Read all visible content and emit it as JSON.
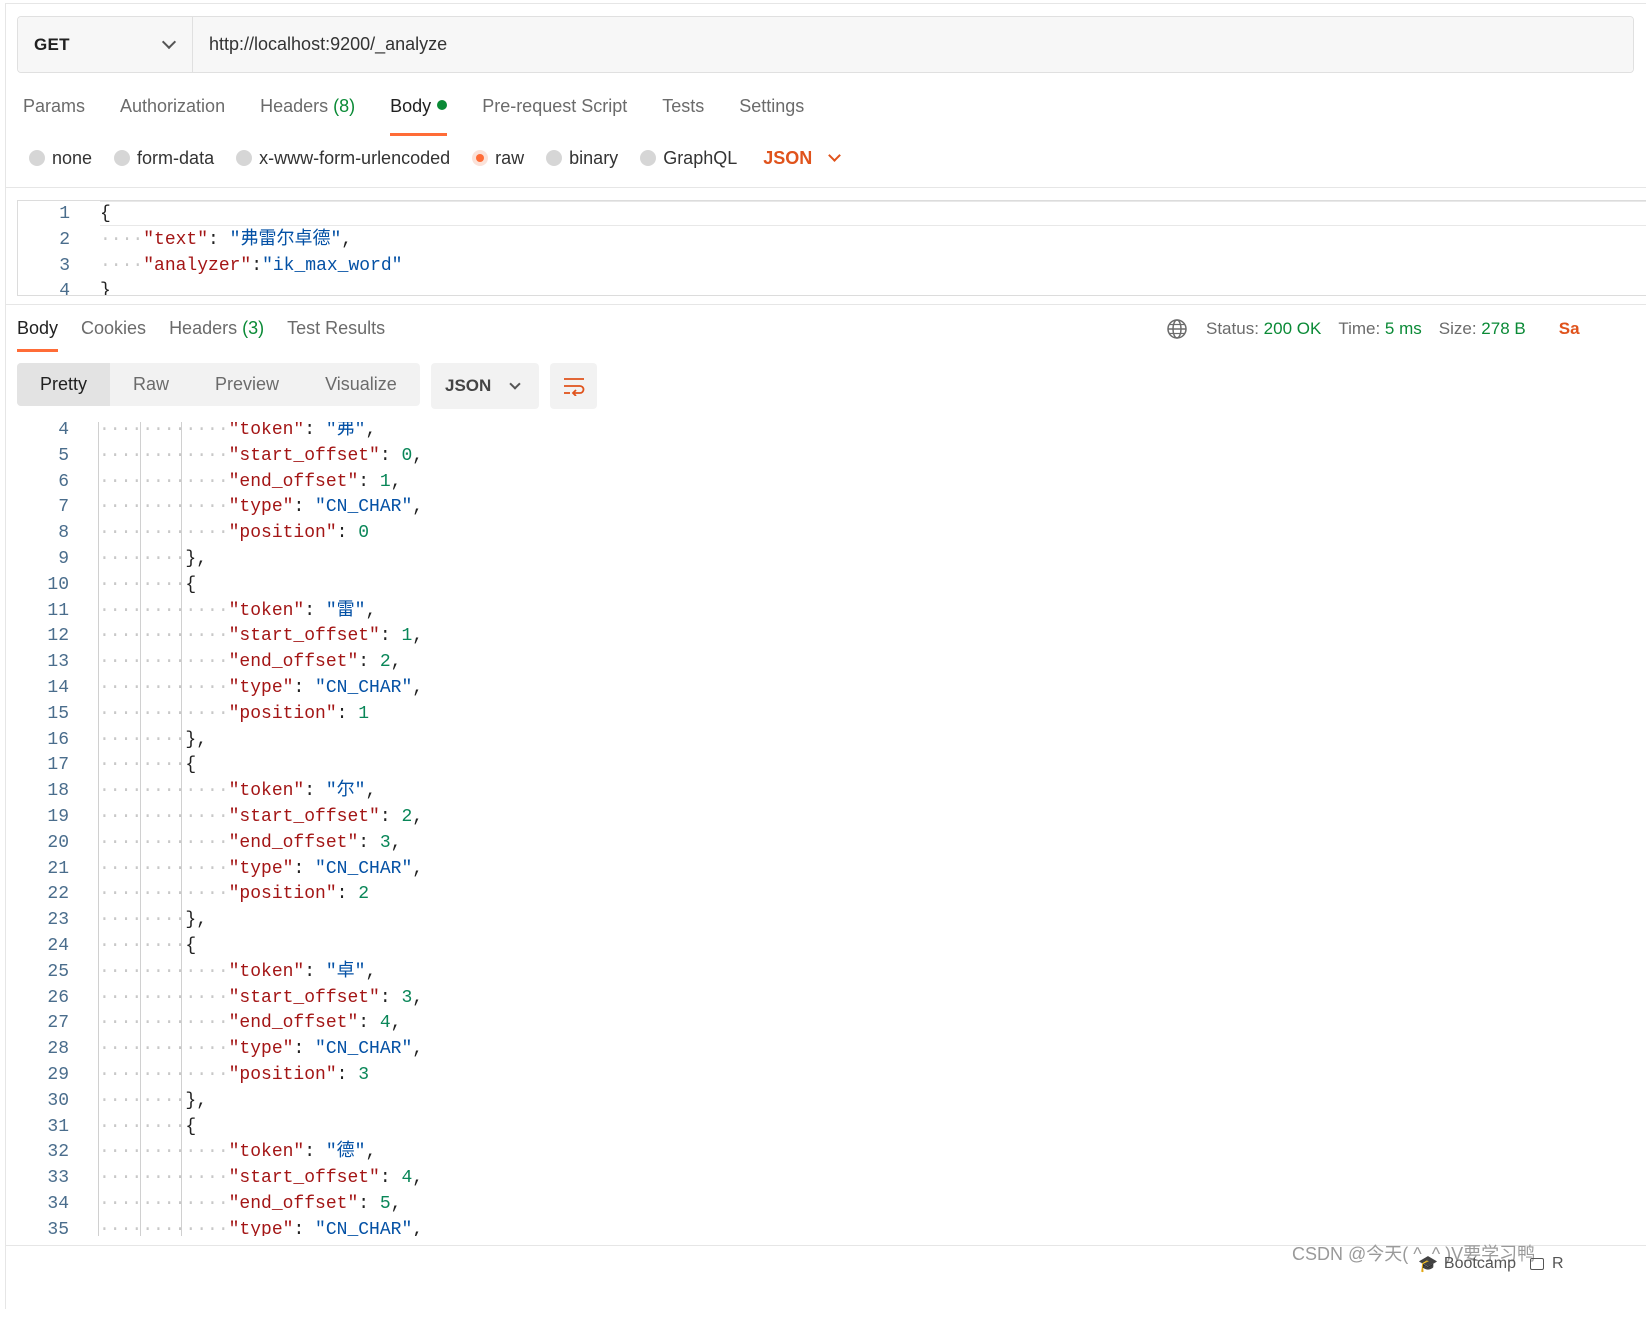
{
  "request": {
    "method": "GET",
    "url": "http://localhost:9200/_analyze"
  },
  "request_tabs": [
    {
      "label": "Params",
      "count": ""
    },
    {
      "label": "Authorization",
      "count": ""
    },
    {
      "label": "Headers",
      "count": "(8)"
    },
    {
      "label": "Body",
      "count": "",
      "active": true,
      "dot": true
    },
    {
      "label": "Pre-request Script",
      "count": ""
    },
    {
      "label": "Tests",
      "count": ""
    },
    {
      "label": "Settings",
      "count": ""
    }
  ],
  "body_types": [
    {
      "label": "none",
      "checked": false
    },
    {
      "label": "form-data",
      "checked": false
    },
    {
      "label": "x-www-form-urlencoded",
      "checked": false
    },
    {
      "label": "raw",
      "checked": true
    },
    {
      "label": "binary",
      "checked": false
    },
    {
      "label": "GraphQL",
      "checked": false
    }
  ],
  "body_format": "JSON",
  "request_body_lines": [
    {
      "n": "1",
      "tokens": [
        [
          "p",
          "{"
        ]
      ]
    },
    {
      "n": "2",
      "tokens": [
        [
          "d",
          "····"
        ],
        [
          "k",
          "\"text\""
        ],
        [
          "p",
          ": "
        ],
        [
          "s",
          "\"弗雷尔卓德\""
        ],
        [
          "p",
          ","
        ]
      ]
    },
    {
      "n": "3",
      "tokens": [
        [
          "d",
          "····"
        ],
        [
          "k",
          "\"analyzer\""
        ],
        [
          "p",
          ":"
        ],
        [
          "s",
          "\"ik_max_word\""
        ]
      ]
    },
    {
      "n": "4",
      "tokens": [
        [
          "p",
          "}"
        ]
      ]
    }
  ],
  "response_tabs": [
    {
      "label": "Body",
      "count": "",
      "active": true
    },
    {
      "label": "Cookies",
      "count": ""
    },
    {
      "label": "Headers",
      "count": "(3)"
    },
    {
      "label": "Test Results",
      "count": ""
    }
  ],
  "response_meta": {
    "status_label": "Status:",
    "status_value": "200 OK",
    "time_label": "Time:",
    "time_value": "5 ms",
    "size_label": "Size:",
    "size_value": "278 B",
    "save_label": "Sa"
  },
  "view_modes": [
    "Pretty",
    "Raw",
    "Preview",
    "Visualize"
  ],
  "response_format": "JSON",
  "response_lines": [
    {
      "n": "4",
      "tokens": [
        [
          "d",
          "············"
        ],
        [
          "k",
          "\"token\""
        ],
        [
          "p",
          ": "
        ],
        [
          "s",
          "\"弗\""
        ],
        [
          "p",
          ","
        ]
      ]
    },
    {
      "n": "5",
      "tokens": [
        [
          "d",
          "············"
        ],
        [
          "k",
          "\"start_offset\""
        ],
        [
          "p",
          ": "
        ],
        [
          "n",
          "0"
        ],
        [
          "p",
          ","
        ]
      ]
    },
    {
      "n": "6",
      "tokens": [
        [
          "d",
          "············"
        ],
        [
          "k",
          "\"end_offset\""
        ],
        [
          "p",
          ": "
        ],
        [
          "n",
          "1"
        ],
        [
          "p",
          ","
        ]
      ]
    },
    {
      "n": "7",
      "tokens": [
        [
          "d",
          "············"
        ],
        [
          "k",
          "\"type\""
        ],
        [
          "p",
          ": "
        ],
        [
          "s",
          "\"CN_CHAR\""
        ],
        [
          "p",
          ","
        ]
      ]
    },
    {
      "n": "8",
      "tokens": [
        [
          "d",
          "············"
        ],
        [
          "k",
          "\"position\""
        ],
        [
          "p",
          ": "
        ],
        [
          "n",
          "0"
        ]
      ]
    },
    {
      "n": "9",
      "tokens": [
        [
          "d",
          "········"
        ],
        [
          "p",
          "},"
        ]
      ]
    },
    {
      "n": "10",
      "tokens": [
        [
          "d",
          "········"
        ],
        [
          "p",
          "{"
        ]
      ]
    },
    {
      "n": "11",
      "tokens": [
        [
          "d",
          "············"
        ],
        [
          "k",
          "\"token\""
        ],
        [
          "p",
          ": "
        ],
        [
          "s",
          "\"雷\""
        ],
        [
          "p",
          ","
        ]
      ]
    },
    {
      "n": "12",
      "tokens": [
        [
          "d",
          "············"
        ],
        [
          "k",
          "\"start_offset\""
        ],
        [
          "p",
          ": "
        ],
        [
          "n",
          "1"
        ],
        [
          "p",
          ","
        ]
      ]
    },
    {
      "n": "13",
      "tokens": [
        [
          "d",
          "············"
        ],
        [
          "k",
          "\"end_offset\""
        ],
        [
          "p",
          ": "
        ],
        [
          "n",
          "2"
        ],
        [
          "p",
          ","
        ]
      ]
    },
    {
      "n": "14",
      "tokens": [
        [
          "d",
          "············"
        ],
        [
          "k",
          "\"type\""
        ],
        [
          "p",
          ": "
        ],
        [
          "s",
          "\"CN_CHAR\""
        ],
        [
          "p",
          ","
        ]
      ]
    },
    {
      "n": "15",
      "tokens": [
        [
          "d",
          "············"
        ],
        [
          "k",
          "\"position\""
        ],
        [
          "p",
          ": "
        ],
        [
          "n",
          "1"
        ]
      ]
    },
    {
      "n": "16",
      "tokens": [
        [
          "d",
          "········"
        ],
        [
          "p",
          "},"
        ]
      ]
    },
    {
      "n": "17",
      "tokens": [
        [
          "d",
          "········"
        ],
        [
          "p",
          "{"
        ]
      ]
    },
    {
      "n": "18",
      "tokens": [
        [
          "d",
          "············"
        ],
        [
          "k",
          "\"token\""
        ],
        [
          "p",
          ": "
        ],
        [
          "s",
          "\"尔\""
        ],
        [
          "p",
          ","
        ]
      ]
    },
    {
      "n": "19",
      "tokens": [
        [
          "d",
          "············"
        ],
        [
          "k",
          "\"start_offset\""
        ],
        [
          "p",
          ": "
        ],
        [
          "n",
          "2"
        ],
        [
          "p",
          ","
        ]
      ]
    },
    {
      "n": "20",
      "tokens": [
        [
          "d",
          "············"
        ],
        [
          "k",
          "\"end_offset\""
        ],
        [
          "p",
          ": "
        ],
        [
          "n",
          "3"
        ],
        [
          "p",
          ","
        ]
      ]
    },
    {
      "n": "21",
      "tokens": [
        [
          "d",
          "············"
        ],
        [
          "k",
          "\"type\""
        ],
        [
          "p",
          ": "
        ],
        [
          "s",
          "\"CN_CHAR\""
        ],
        [
          "p",
          ","
        ]
      ]
    },
    {
      "n": "22",
      "tokens": [
        [
          "d",
          "············"
        ],
        [
          "k",
          "\"position\""
        ],
        [
          "p",
          ": "
        ],
        [
          "n",
          "2"
        ]
      ]
    },
    {
      "n": "23",
      "tokens": [
        [
          "d",
          "········"
        ],
        [
          "p",
          "},"
        ]
      ]
    },
    {
      "n": "24",
      "tokens": [
        [
          "d",
          "········"
        ],
        [
          "p",
          "{"
        ]
      ]
    },
    {
      "n": "25",
      "tokens": [
        [
          "d",
          "············"
        ],
        [
          "k",
          "\"token\""
        ],
        [
          "p",
          ": "
        ],
        [
          "s",
          "\"卓\""
        ],
        [
          "p",
          ","
        ]
      ]
    },
    {
      "n": "26",
      "tokens": [
        [
          "d",
          "············"
        ],
        [
          "k",
          "\"start_offset\""
        ],
        [
          "p",
          ": "
        ],
        [
          "n",
          "3"
        ],
        [
          "p",
          ","
        ]
      ]
    },
    {
      "n": "27",
      "tokens": [
        [
          "d",
          "············"
        ],
        [
          "k",
          "\"end_offset\""
        ],
        [
          "p",
          ": "
        ],
        [
          "n",
          "4"
        ],
        [
          "p",
          ","
        ]
      ]
    },
    {
      "n": "28",
      "tokens": [
        [
          "d",
          "············"
        ],
        [
          "k",
          "\"type\""
        ],
        [
          "p",
          ": "
        ],
        [
          "s",
          "\"CN_CHAR\""
        ],
        [
          "p",
          ","
        ]
      ]
    },
    {
      "n": "29",
      "tokens": [
        [
          "d",
          "············"
        ],
        [
          "k",
          "\"position\""
        ],
        [
          "p",
          ": "
        ],
        [
          "n",
          "3"
        ]
      ]
    },
    {
      "n": "30",
      "tokens": [
        [
          "d",
          "········"
        ],
        [
          "p",
          "},"
        ]
      ]
    },
    {
      "n": "31",
      "tokens": [
        [
          "d",
          "········"
        ],
        [
          "p",
          "{"
        ]
      ]
    },
    {
      "n": "32",
      "tokens": [
        [
          "d",
          "············"
        ],
        [
          "k",
          "\"token\""
        ],
        [
          "p",
          ": "
        ],
        [
          "s",
          "\"德\""
        ],
        [
          "p",
          ","
        ]
      ]
    },
    {
      "n": "33",
      "tokens": [
        [
          "d",
          "············"
        ],
        [
          "k",
          "\"start_offset\""
        ],
        [
          "p",
          ": "
        ],
        [
          "n",
          "4"
        ],
        [
          "p",
          ","
        ]
      ]
    },
    {
      "n": "34",
      "tokens": [
        [
          "d",
          "············"
        ],
        [
          "k",
          "\"end_offset\""
        ],
        [
          "p",
          ": "
        ],
        [
          "n",
          "5"
        ],
        [
          "p",
          ","
        ]
      ]
    },
    {
      "n": "35",
      "tokens": [
        [
          "d",
          "············"
        ],
        [
          "k",
          "\"type\""
        ],
        [
          "p",
          ": "
        ],
        [
          "s",
          "\"CN_CHAR\""
        ],
        [
          "p",
          ","
        ]
      ]
    }
  ],
  "watermark": "CSDN @今天( ^_^ )V要学习鸭",
  "footer": {
    "bootcamp_label": "Bootcamp",
    "extra_label": "R"
  },
  "colors": {
    "accent": "#ff6c37",
    "success": "#0a8a36",
    "json_key": "#a31515",
    "json_string": "#0451a5",
    "json_number": "#098658"
  }
}
